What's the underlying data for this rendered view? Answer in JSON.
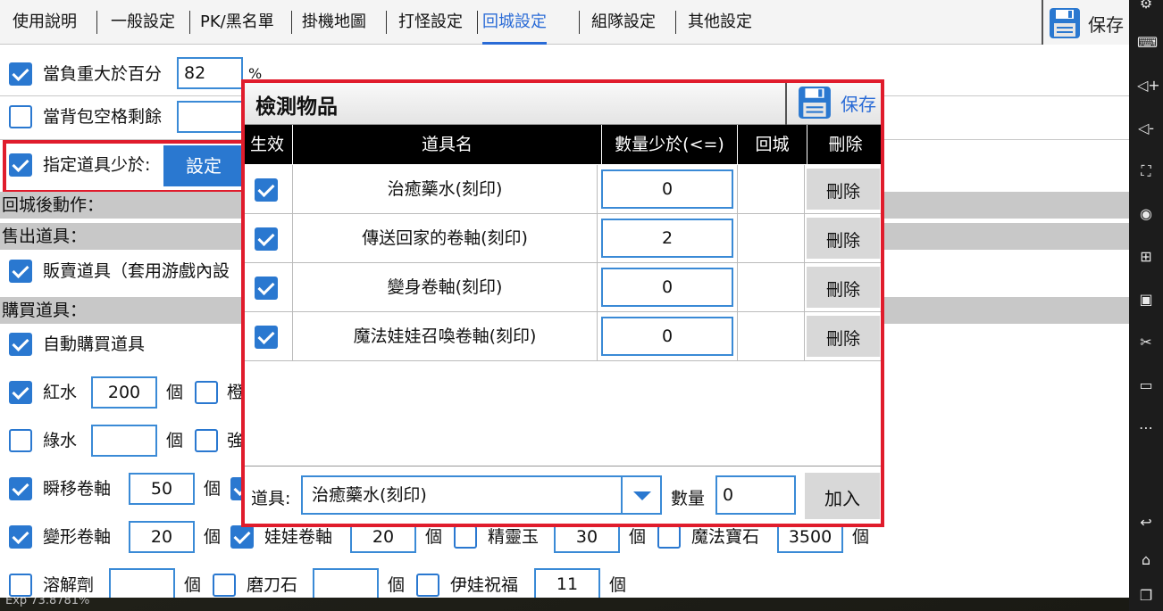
{
  "tabs": [
    {
      "label": "使用說明",
      "active": false
    },
    {
      "label": "一般設定",
      "active": false
    },
    {
      "label": "PK/黑名單",
      "active": false
    },
    {
      "label": "掛機地圖",
      "active": false
    },
    {
      "label": "打怪設定",
      "active": false
    },
    {
      "label": "回城設定",
      "active": true
    },
    {
      "label": "組隊設定",
      "active": false
    },
    {
      "label": "其他設定",
      "active": false
    }
  ],
  "save_label": "保存",
  "form": {
    "weight_label": "當負重大於百分",
    "weight_value": "82",
    "weight_unit": "%",
    "bag_label": "當背包空格剩餘",
    "bag_value": "",
    "item_label": "指定道具少於:",
    "set_button": "設定",
    "after_return_header": "回城後動作：",
    "sell_header": "售出道具：",
    "sell_label": "販賣道具（套用游戲內設",
    "buy_header": "購買道具：",
    "auto_buy_label": "自動購買道具",
    "unit": "個",
    "buy_rows": [
      [
        {
          "label": "紅水",
          "value": "200",
          "checked": true
        },
        {
          "label": "橙",
          "value": null,
          "checked": false
        }
      ],
      [
        {
          "label": "綠水",
          "value": "",
          "checked": false
        },
        {
          "label": "強",
          "value": null,
          "checked": false
        }
      ],
      [
        {
          "label": "瞬移卷軸",
          "value": "50",
          "checked": true
        }
      ],
      [
        {
          "label": "變形卷軸",
          "value": "20",
          "checked": true
        },
        {
          "label": "娃娃卷軸",
          "value": "20",
          "checked": true
        },
        {
          "label": "精靈玉",
          "value": "30",
          "checked": false
        },
        {
          "label": "魔法寶石",
          "value": "3500",
          "checked": false
        }
      ],
      [
        {
          "label": "溶解劑",
          "value": "",
          "checked": false
        },
        {
          "label": "磨刀石",
          "value": "",
          "checked": false
        },
        {
          "label": "伊娃祝福",
          "value": "11",
          "checked": false
        }
      ]
    ]
  },
  "dialog": {
    "title": "檢測物品",
    "save_label": "保存",
    "columns": [
      "生效",
      "道具名",
      "數量少於(<=)",
      "回城",
      "刪除"
    ],
    "rows": [
      {
        "enabled": true,
        "name": "治癒藥水(刻印)",
        "qty": "0",
        "delete": "刪除"
      },
      {
        "enabled": true,
        "name": "傳送回家的卷軸(刻印)",
        "qty": "2",
        "delete": "刪除"
      },
      {
        "enabled": true,
        "name": "變身卷軸(刻印)",
        "qty": "0",
        "delete": "刪除"
      },
      {
        "enabled": true,
        "name": "魔法娃娃召喚卷軸(刻印)",
        "qty": "0",
        "delete": "刪除"
      }
    ],
    "footer": {
      "item_label": "道具:",
      "selected_item": "治癒藥水(刻印)",
      "qty_label": "數量",
      "qty_value": "0",
      "add_button": "加入"
    }
  },
  "game": {
    "exp_text": "Exp 73.8781%"
  },
  "colors": {
    "accent": "#2a78d0",
    "highlight_frame": "#e01c2c",
    "section_bg": "#c8c8c8"
  },
  "side_icons": [
    "settings-icon",
    "keyboard-icon",
    "volume-up-icon",
    "volume-down-icon",
    "screenshot-icon",
    "record-icon",
    "add-icon",
    "apk-icon",
    "scissors-icon",
    "video-icon",
    "more-icon",
    "back-icon",
    "home-icon",
    "recents-icon"
  ]
}
